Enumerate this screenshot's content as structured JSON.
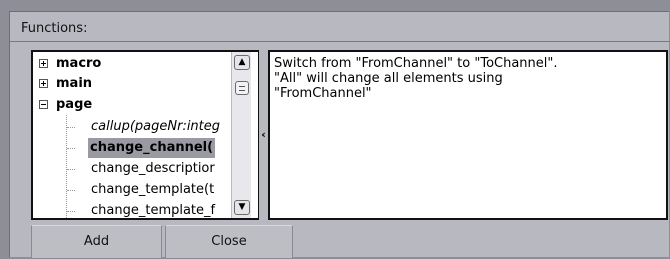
{
  "panel": {
    "title": "Functions:"
  },
  "tree": {
    "items": [
      {
        "label": "macro",
        "expander": "plus"
      },
      {
        "label": "main",
        "expander": "plus"
      },
      {
        "label": "page",
        "expander": "minus"
      },
      {
        "label": "callup(pageNr:integ"
      },
      {
        "label": "change_channel(",
        "selected": true
      },
      {
        "label": "change_descriptior"
      },
      {
        "label": "change_template(t"
      },
      {
        "label": "change_template_f"
      }
    ]
  },
  "scrollbar": {
    "up_icon": "chevron-up-icon",
    "down_icon": "chevron-down-icon"
  },
  "splitter": {
    "glyph": "‹"
  },
  "description": {
    "lines": [
      "Switch from \"FromChannel\" to \"ToChannel\".",
      "\"All\" will change all elements using",
      "\"FromChannel\""
    ]
  },
  "buttons": {
    "add": "Add",
    "close": "Close"
  }
}
